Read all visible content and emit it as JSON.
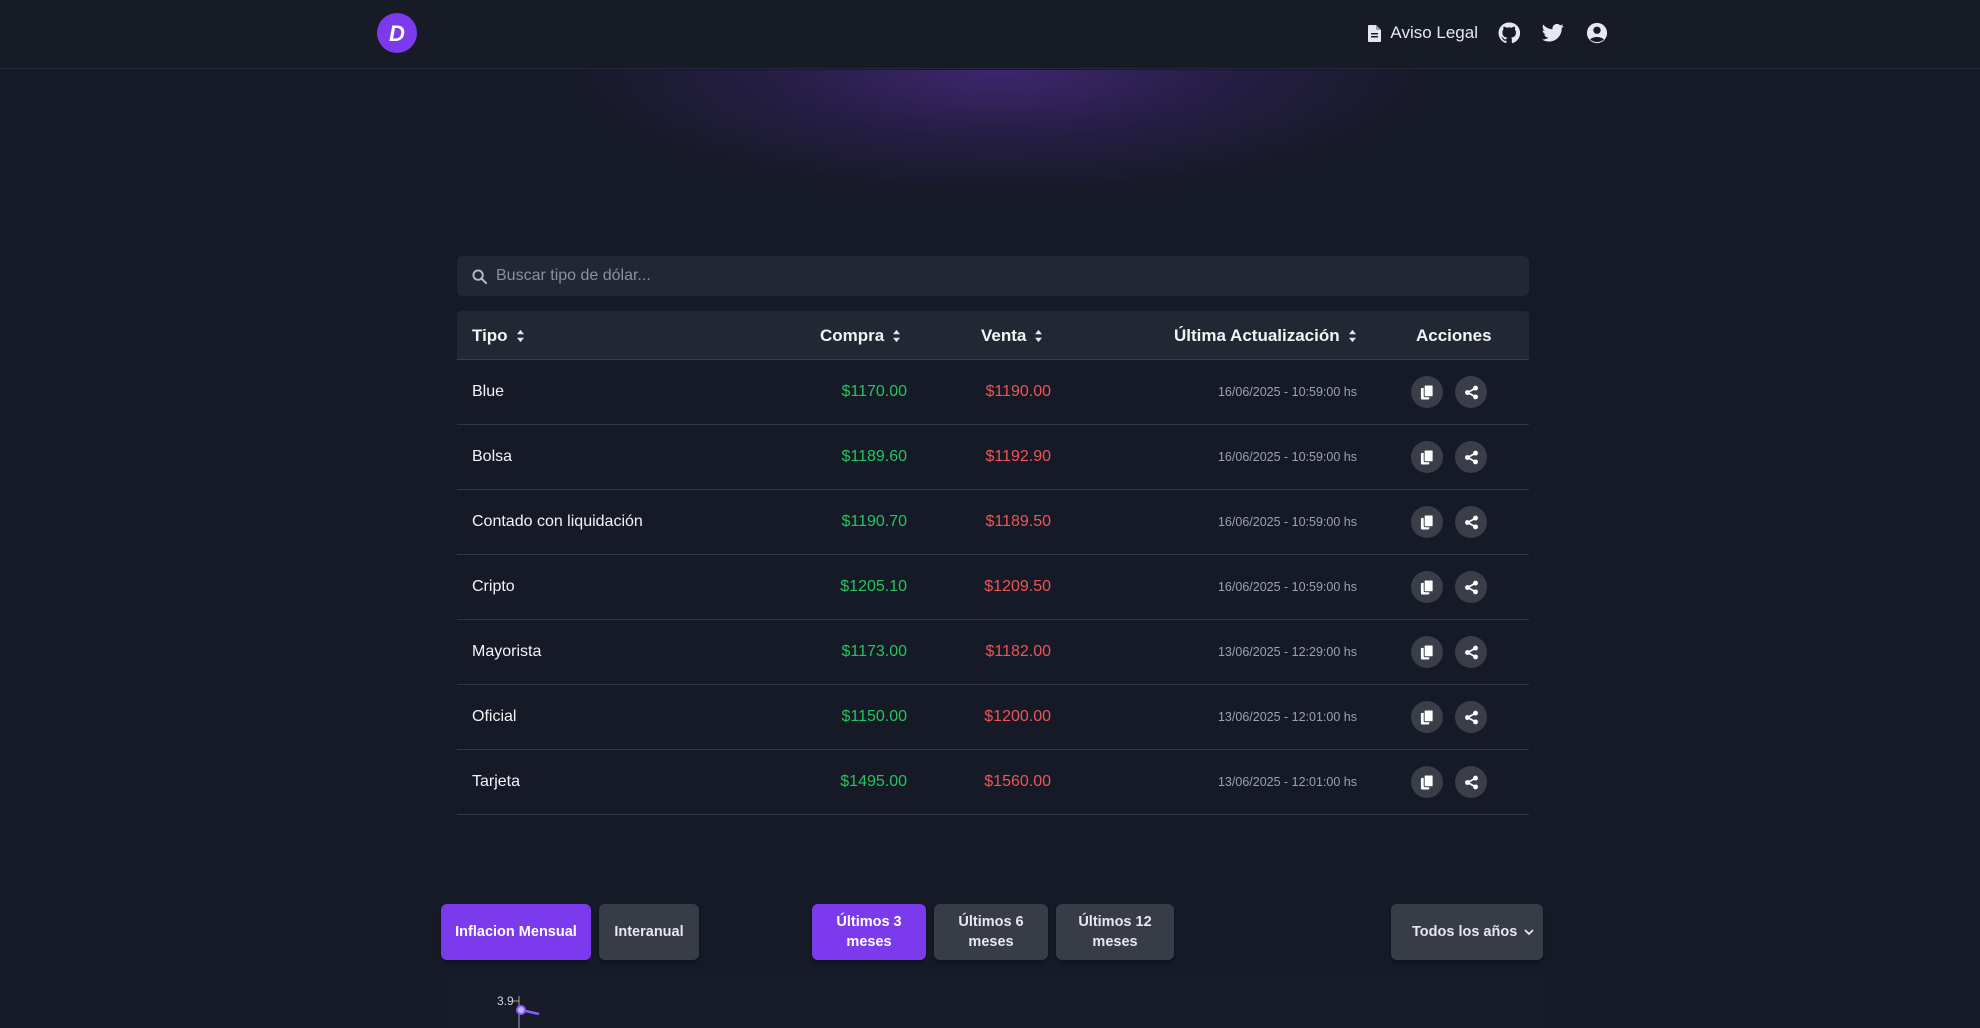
{
  "header": {
    "logo_letter": "D",
    "aviso_label": "Aviso Legal"
  },
  "search": {
    "placeholder": "Buscar tipo de dólar..."
  },
  "table": {
    "headers": {
      "tipo": "Tipo",
      "compra": "Compra",
      "venta": "Venta",
      "actualizacion": "Última Actualización",
      "acciones": "Acciones"
    },
    "rows": [
      {
        "tipo": "Blue",
        "compra": "$1170.00",
        "venta": "$1190.00",
        "fecha": "16/06/2025 - 10:59:00 hs"
      },
      {
        "tipo": "Bolsa",
        "compra": "$1189.60",
        "venta": "$1192.90",
        "fecha": "16/06/2025 - 10:59:00 hs"
      },
      {
        "tipo": "Contado con liquidación",
        "compra": "$1190.70",
        "venta": "$1189.50",
        "fecha": "16/06/2025 - 10:59:00 hs"
      },
      {
        "tipo": "Cripto",
        "compra": "$1205.10",
        "venta": "$1209.50",
        "fecha": "16/06/2025 - 10:59:00 hs"
      },
      {
        "tipo": "Mayorista",
        "compra": "$1173.00",
        "venta": "$1182.00",
        "fecha": "13/06/2025 - 12:29:00 hs"
      },
      {
        "tipo": "Oficial",
        "compra": "$1150.00",
        "venta": "$1200.00",
        "fecha": "13/06/2025 - 12:01:00 hs"
      },
      {
        "tipo": "Tarjeta",
        "compra": "$1495.00",
        "venta": "$1560.00",
        "fecha": "13/06/2025 - 12:01:00 hs"
      }
    ]
  },
  "inflation": {
    "mode_buttons": [
      "Inflacion Mensual",
      "Interanual"
    ],
    "active_mode": 0,
    "range_buttons": [
      "Últimos 3 meses",
      "Últimos 6 meses",
      "Últimos 12 meses"
    ],
    "active_range": 0,
    "year_select": "Todos los años",
    "chart_top_tick": "3.9"
  },
  "colors": {
    "accent": "#7c3aed",
    "buy": "#22c55e",
    "sell": "#ef5454"
  }
}
